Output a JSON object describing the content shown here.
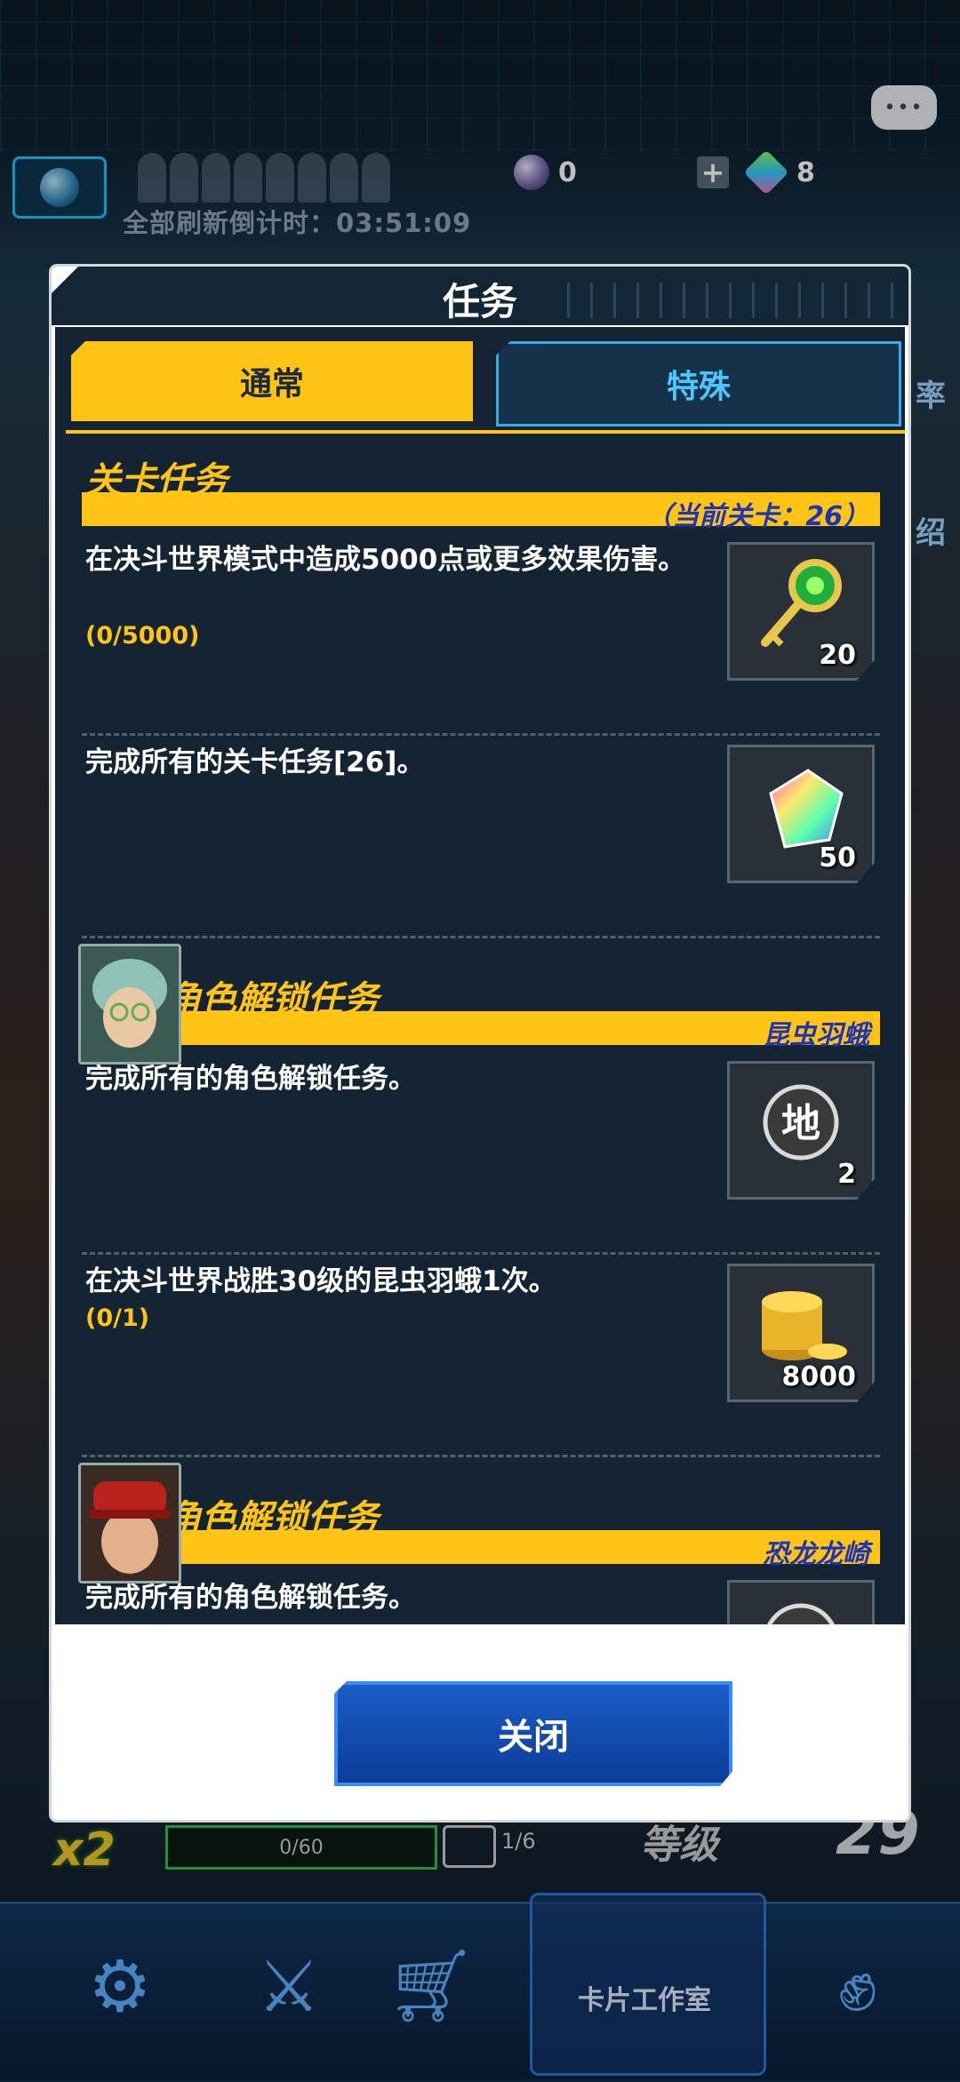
{
  "status": {
    "currency_orb": "0",
    "currency_gem": "8",
    "plus": "+",
    "countdown": "全部刷新倒计时：03:51:09",
    "chat": "•••"
  },
  "side": {
    "rate": "率",
    "intro": "绍"
  },
  "modal": {
    "title": "任务",
    "tabs": [
      {
        "label": "通常"
      },
      {
        "label": "特殊"
      }
    ],
    "stage_section": {
      "title": "关卡任务",
      "subtitle": "（当前关卡：26）"
    },
    "stage_tasks": [
      {
        "text": "在决斗世界模式中造成5000点或更多效果伤害。",
        "progress": "(0/5000)",
        "reward_icon": "key-icon",
        "reward_count": "20"
      },
      {
        "text": "完成所有的关卡任务[26]。",
        "progress": "",
        "reward_icon": "rainbow-gem-icon",
        "reward_count": "50"
      }
    ],
    "char_sections": [
      {
        "title": "角色解锁任务",
        "name": "昆虫羽蛾",
        "tasks": [
          {
            "text": "完成所有的角色解锁任务。",
            "progress": "",
            "reward_icon": "earth-orb-icon",
            "reward_count": "2"
          },
          {
            "text": "在决斗世界战胜30级的昆虫羽蛾1次。",
            "progress": "(0/1)",
            "reward_icon": "gold-coins-icon",
            "reward_count": "8000"
          }
        ]
      },
      {
        "title": "角色解锁任务",
        "name": "恐龙龙崎",
        "tasks": [
          {
            "text": "完成所有的角色解锁任务。",
            "progress": "",
            "reward_icon": "orb-icon",
            "reward_count": ""
          }
        ]
      }
    ],
    "close_label": "关闭"
  },
  "hud": {
    "multiplier": "x2",
    "xp": "0/60",
    "chest": "1/6",
    "level_label": "等级",
    "level": "29"
  },
  "nav": {
    "center_label": "卡片工作室"
  },
  "colors": {
    "accent": "#ffc414",
    "panel": "#142433",
    "button": "#0c3c98"
  }
}
